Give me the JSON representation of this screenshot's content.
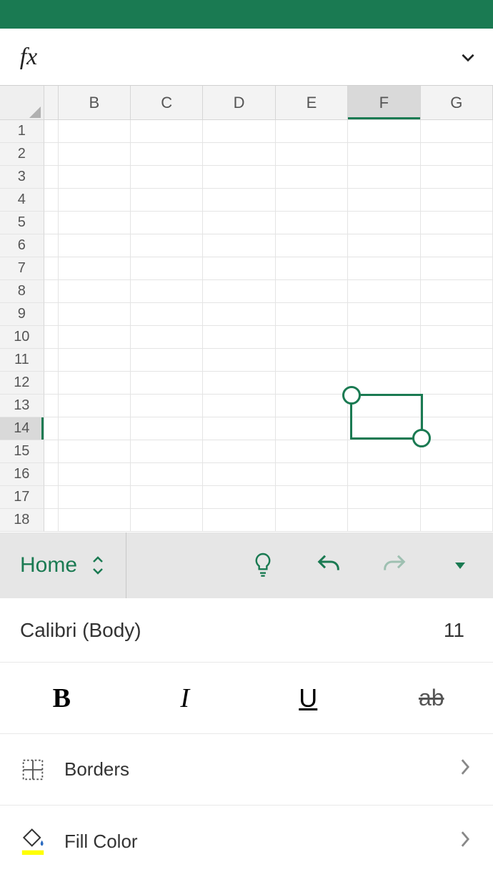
{
  "titlebar": {
    "color": "#1a7a52"
  },
  "formula_bar": {
    "fx_label": "fx",
    "value": ""
  },
  "grid": {
    "columns": [
      "B",
      "C",
      "D",
      "E",
      "F",
      "G"
    ],
    "selected_column": "F",
    "rows": [
      1,
      2,
      3,
      4,
      5,
      6,
      7,
      8,
      9,
      10,
      11,
      12,
      13,
      14,
      15,
      16,
      17,
      18
    ],
    "selected_row": 14,
    "selection": {
      "col": "F",
      "row_start": 13,
      "row_end": 14
    }
  },
  "ribbon": {
    "active_tab": "Home",
    "icons": {
      "tips": "lightbulb",
      "undo": "undo",
      "redo": "redo",
      "more": "caret-down"
    }
  },
  "format_panel": {
    "font_name": "Calibri (Body)",
    "font_size": "11",
    "bold_label": "B",
    "italic_label": "I",
    "underline_label": "U",
    "strike_label": "ab",
    "borders_label": "Borders",
    "fill_label": "Fill Color",
    "fill_swatch": "#ffff00"
  }
}
